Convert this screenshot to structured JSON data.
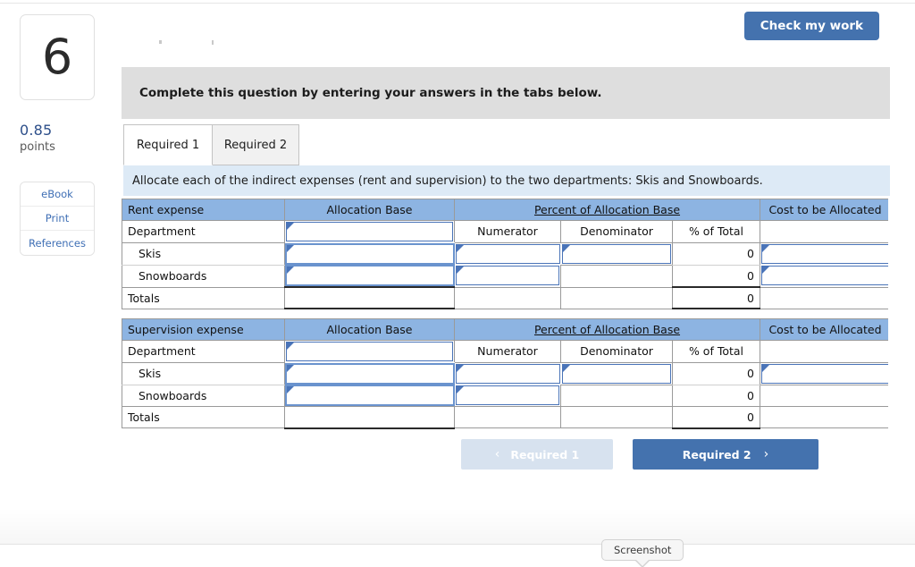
{
  "sidebar": {
    "question_number": "6",
    "points_value": "0.85",
    "points_label": "points",
    "buttons": [
      {
        "label": "eBook",
        "name": "ebook"
      },
      {
        "label": "Print",
        "name": "print"
      },
      {
        "label": "References",
        "name": "references"
      }
    ]
  },
  "header": {
    "check_my_work_label": "Check my work"
  },
  "banner": {
    "text": "Complete this question by entering your answers in the tabs below."
  },
  "tabs": [
    {
      "label": "Required 1",
      "active": true
    },
    {
      "label": "Required 2",
      "active": false
    }
  ],
  "instruction": {
    "text": "Allocate each of the indirect expenses (rent and supervision) to the two departments: Skis and Snowboards."
  },
  "colors": {
    "header_blue": "#8db4e2",
    "accent_blue": "#4472ae",
    "instruction_blue": "#ddeaf6",
    "banner_gray": "#dedede",
    "input_border": "#4a74b8",
    "link_blue": "#3f6fb5"
  },
  "tables": [
    {
      "name": "rent-expense-table",
      "title": "Rent expense",
      "group_headers": {
        "allocation_base": "Allocation Base",
        "percent_of_allocation_base": "Percent of Allocation Base",
        "cost_to_be_allocated": "Cost to be Allocated"
      },
      "sub_headers": {
        "department": "Department",
        "numerator": "Numerator",
        "denominator": "Denominator",
        "percent_of_total": "% of Total"
      },
      "rows": [
        {
          "label": "Skis",
          "indent": true,
          "percent_of_total": "0"
        },
        {
          "label": "Snowboards",
          "indent": true,
          "percent_of_total": "0"
        },
        {
          "label": "Totals",
          "indent": false,
          "percent_of_total": "0"
        }
      ]
    },
    {
      "name": "supervision-expense-table",
      "title": "Supervision expense",
      "group_headers": {
        "allocation_base": "Allocation Base",
        "percent_of_allocation_base": "Percent of Allocation Base",
        "cost_to_be_allocated": "Cost to be Allocated"
      },
      "sub_headers": {
        "department": "Department",
        "numerator": "Numerator",
        "denominator": "Denominator",
        "percent_of_total": "% of Total"
      },
      "rows": [
        {
          "label": "Skis",
          "indent": true,
          "percent_of_total": "0"
        },
        {
          "label": "Snowboards",
          "indent": true,
          "percent_of_total": "0"
        },
        {
          "label": "Totals",
          "indent": false,
          "percent_of_total": "0"
        }
      ]
    }
  ],
  "nav": {
    "prev_label": "Required 1",
    "prev_chevron": "‹",
    "next_label": "Required 2",
    "next_chevron": "›"
  },
  "tooltip": {
    "label": "Screenshot"
  }
}
